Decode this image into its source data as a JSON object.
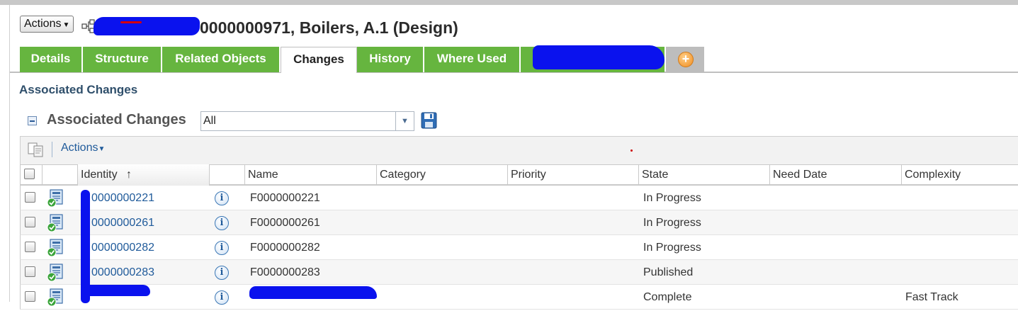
{
  "header": {
    "actions_label": "Actions",
    "title_visible": "0000000971, Boilers, A.1 (Design)"
  },
  "tabs": [
    {
      "label": "Details",
      "active": false
    },
    {
      "label": "Structure",
      "active": false
    },
    {
      "label": "Related Objects",
      "active": false
    },
    {
      "label": "Changes",
      "active": true
    },
    {
      "label": "History",
      "active": false
    },
    {
      "label": "Where Used",
      "active": false
    }
  ],
  "section_heading": "Associated Changes",
  "table": {
    "title": "Associated Changes",
    "filter": {
      "selected": "All"
    },
    "toolbar_actions_label": "Actions",
    "columns": [
      "Identity",
      "Name",
      "Category",
      "Priority",
      "State",
      "Need Date",
      "Complexity"
    ],
    "sort_indicator": "↑",
    "rows": [
      {
        "identity": "0000000221",
        "name": "F0000000221",
        "category": "",
        "priority": "",
        "state": "In Progress",
        "need_date": "",
        "complexity": ""
      },
      {
        "identity": "0000000261",
        "name": "F0000000261",
        "category": "",
        "priority": "",
        "state": "In Progress",
        "need_date": "",
        "complexity": ""
      },
      {
        "identity": "0000000282",
        "name": "F0000000282",
        "category": "",
        "priority": "",
        "state": "In Progress",
        "need_date": "",
        "complexity": ""
      },
      {
        "identity": "0000000283",
        "name": "F0000000283",
        "category": "",
        "priority": "",
        "state": "Published",
        "need_date": "",
        "complexity": ""
      },
      {
        "identity": "",
        "name": "",
        "category": "",
        "priority": "",
        "state": "Complete",
        "need_date": "",
        "complexity": "Fast Track"
      }
    ]
  },
  "colors": {
    "tab_green": "#66b53f",
    "link_blue": "#1f5a9a",
    "heading_blue": "#2f4f6b",
    "redaction_blue": "#0a12ee"
  },
  "icons": {
    "actions_caret": "chevron-down-icon",
    "structure": "structure-icon",
    "add_tab": "plus-circle-icon",
    "collapse": "collapse-icon",
    "save": "save-icon",
    "copy": "copy-icon",
    "info": "info-icon",
    "change_object": "change-notice-icon"
  }
}
